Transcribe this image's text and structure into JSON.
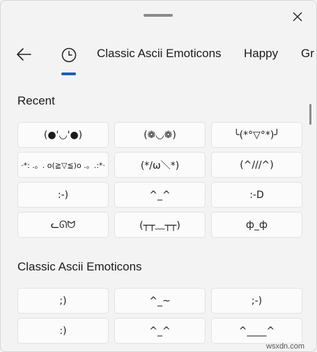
{
  "header": {
    "back_icon": "back-arrow-icon",
    "recent_icon": "clock-icon",
    "close_icon": "close-icon",
    "tabs": [
      "Classic Ascii Emoticons",
      "Happy",
      "Gr"
    ]
  },
  "sections": {
    "recent": {
      "title": "Recent",
      "items": [
        "(●'◡'●)",
        "(❁◡❁)",
        "╰(*°▽°*)╯",
        "·*:  .。. o(≧▽≦)o .。.:*·",
        "(*/ω＼*)",
        "(^///^)",
        ":-)",
        "^_^",
        ":-D",
        "ᓚᘏᗢ",
        "(┬┬﹏┬┬)",
        "ф_ф"
      ]
    },
    "classic": {
      "title": "Classic Ascii Emoticons",
      "items": [
        ";)",
        "^_~",
        ";-)",
        ":)",
        "^_^",
        "^____^"
      ]
    }
  },
  "watermark": "wsxdn.com",
  "colors": {
    "accent": "#1f5fb0",
    "background": "#f3f3f3",
    "tile": "#fbfbfb"
  }
}
